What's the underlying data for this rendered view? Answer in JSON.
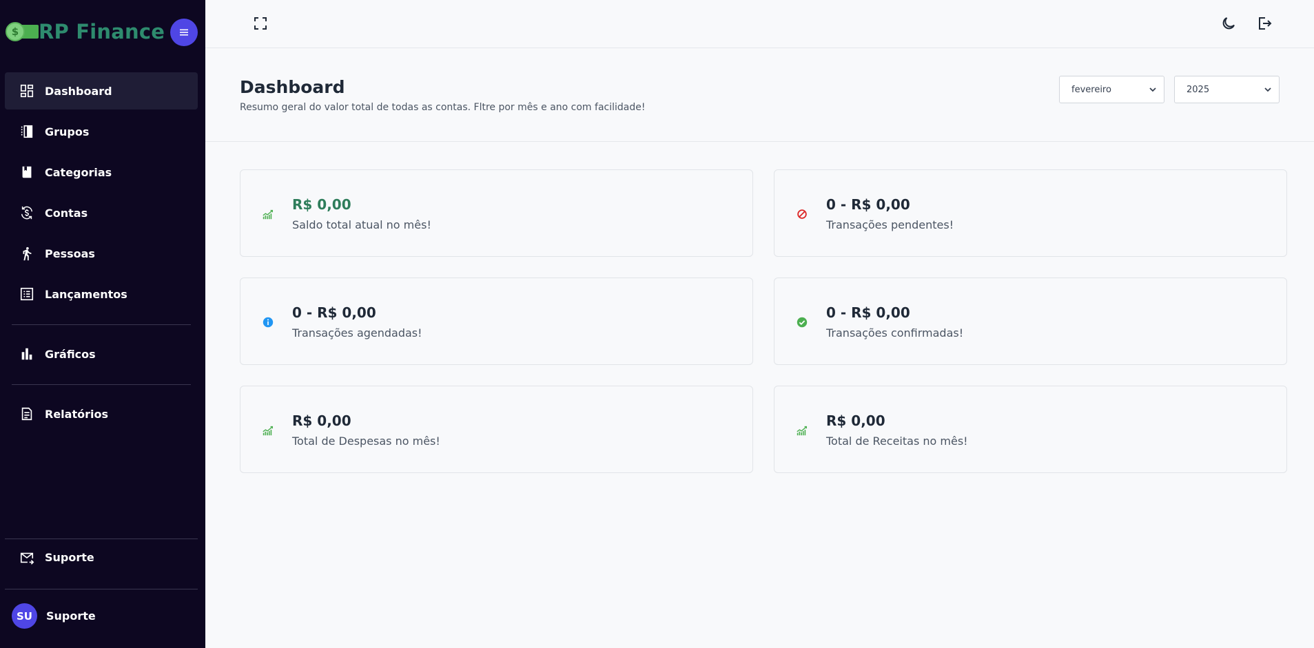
{
  "brand": {
    "name": "RP Finance",
    "coin_symbol": "$"
  },
  "sidebar": {
    "items": [
      {
        "label": "Dashboard",
        "icon": "dashboard-icon",
        "active": true
      },
      {
        "label": "Grupos",
        "icon": "groups-icon"
      },
      {
        "label": "Categorias",
        "icon": "book-icon"
      },
      {
        "label": "Contas",
        "icon": "currency-exchange-icon"
      },
      {
        "label": "Pessoas",
        "icon": "walking-person-icon"
      },
      {
        "label": "Lançamentos",
        "icon": "list-icon"
      },
      {
        "label": "Gráficos",
        "icon": "bar-chart-icon"
      },
      {
        "label": "Relatórios",
        "icon": "report-icon"
      },
      {
        "label": "Suporte",
        "icon": "mail-icon"
      }
    ],
    "user": {
      "initials": "SU",
      "name": "Suporte"
    }
  },
  "header": {
    "title": "Dashboard",
    "subtitle": "Resumo geral do valor total de todas as contas. Fltre por mês e ano com facilidade!",
    "month_select": "fevereiro",
    "year_select": "2025"
  },
  "cards": [
    {
      "value": "R$ 0,00",
      "label": "Saldo total atual no mês!",
      "icon": "trending-chart-icon"
    },
    {
      "value": "0 - R$ 0,00",
      "label": "Transações pendentes!",
      "icon": "blocked-icon"
    },
    {
      "value": "0 - R$ 0,00",
      "label": "Transações agendadas!",
      "icon": "info-icon"
    },
    {
      "value": "0 - R$ 0,00",
      "label": "Transações confirmadas!",
      "icon": "check-circle-icon"
    },
    {
      "value": "R$ 0,00",
      "label": "Total de Despesas no mês!",
      "icon": "trending-chart-icon"
    },
    {
      "value": "R$ 0,00",
      "label": "Total de Receitas no mês!",
      "icon": "trending-chart-icon"
    }
  ],
  "colors": {
    "sidebar_bg": "#0d0721",
    "accent": "#4f46e5",
    "brand_green": "#2e8b6e",
    "status_red": "#dc2626",
    "status_blue": "#2196f3",
    "status_green": "#4caf50"
  }
}
